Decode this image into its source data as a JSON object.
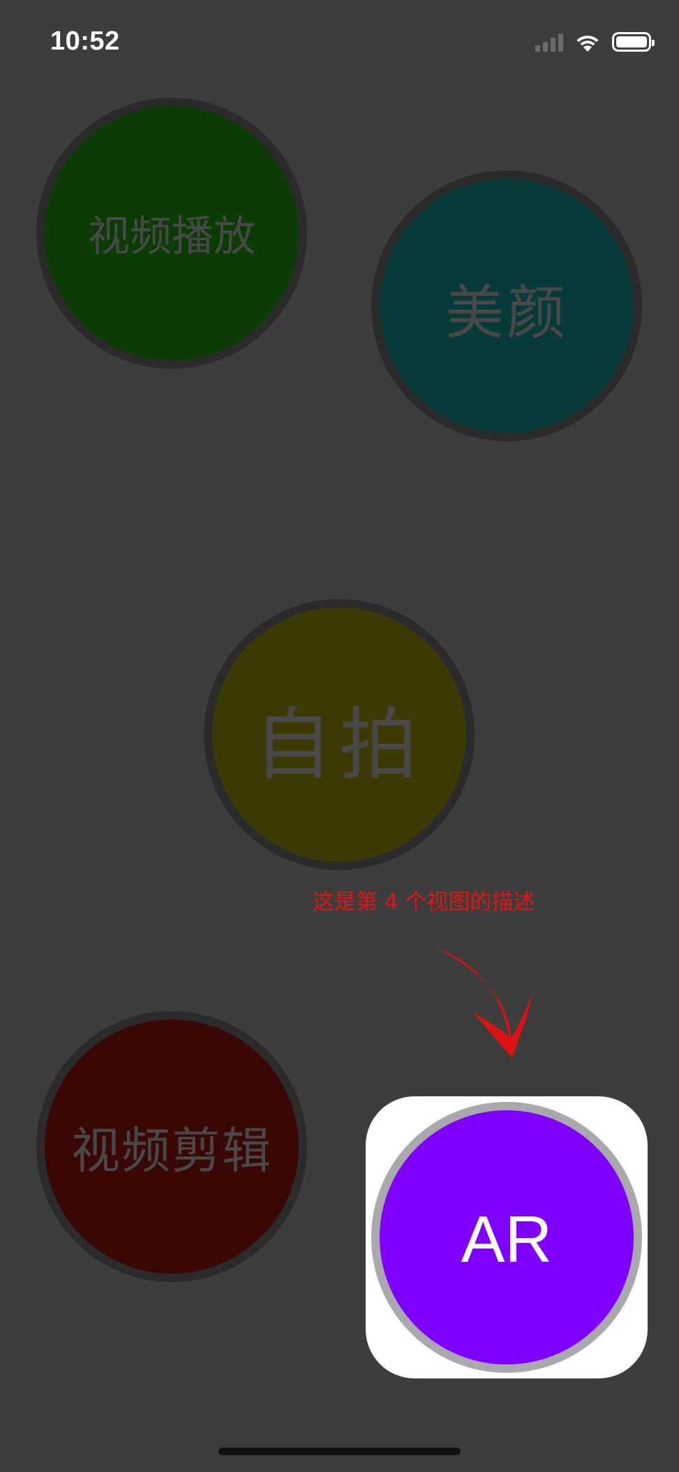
{
  "status_bar": {
    "time": "10:52",
    "icons": [
      "cellular-signal-icon",
      "wifi-icon",
      "battery-icon"
    ]
  },
  "feature_buttons": [
    {
      "id": "video-play",
      "label": "视频播放",
      "color": "#0a3c04"
    },
    {
      "id": "beauty",
      "label": "美颜",
      "color": "#073b3a"
    },
    {
      "id": "selfie",
      "label": "自拍",
      "color": "#3d3a05"
    },
    {
      "id": "video-edit",
      "label": "视频剪辑",
      "color": "#3a0804"
    },
    {
      "id": "ar",
      "label": "AR",
      "color": "#8000ff"
    }
  ],
  "guide": {
    "description": "这是第 4 个视图的描述",
    "description_color": "#e01414",
    "overlay_color": "#3d3d3d",
    "highlight_color": "#ffffff"
  }
}
